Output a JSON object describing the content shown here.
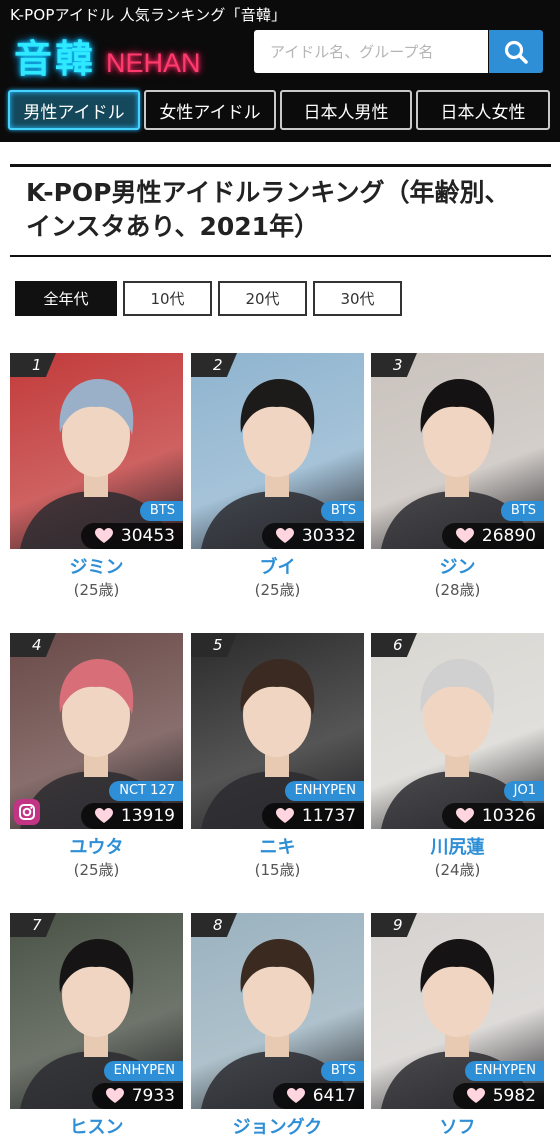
{
  "header": {
    "tagline": "K-POPアイドル 人気ランキング「音韓」",
    "logo_jp": "音韓",
    "logo_en": "NEHAN",
    "search_placeholder": "アイドル名、グループ名"
  },
  "nav": [
    "男性アイドル",
    "女性アイドル",
    "日本人男性",
    "日本人女性"
  ],
  "title": "K-POP男性アイドルランキング（年齢別、インスタあり、2021年）",
  "age_filters": [
    "全年代",
    "10代",
    "20代",
    "30代"
  ],
  "idols": [
    {
      "rank": "1",
      "group": "BTS",
      "likes": "30453",
      "name": "ジミン",
      "age": "(25歳)",
      "bg": "#c23a3a",
      "hair": "#9ab0c8",
      "instagram": false
    },
    {
      "rank": "2",
      "group": "BTS",
      "likes": "30332",
      "name": "ブイ",
      "age": "(25歳)",
      "bg": "#8fb4cf",
      "hair": "#1d1a1a",
      "instagram": false
    },
    {
      "rank": "3",
      "group": "BTS",
      "likes": "26890",
      "name": "ジン",
      "age": "(28歳)",
      "bg": "#c9c2bd",
      "hair": "#141212",
      "instagram": false
    },
    {
      "rank": "4",
      "group": "NCT 127",
      "likes": "13919",
      "name": "ユウタ",
      "age": "(25歳)",
      "bg": "#6a4a48",
      "hair": "#d86e78",
      "instagram": true
    },
    {
      "rank": "5",
      "group": "ENHYPEN",
      "likes": "11737",
      "name": "ニキ",
      "age": "(15歳)",
      "bg": "#2b2b2b",
      "hair": "#3a2a22",
      "instagram": false
    },
    {
      "rank": "6",
      "group": "JO1",
      "likes": "10326",
      "name": "川尻蓮",
      "age": "(24歳)",
      "bg": "#d9d7d2",
      "hair": "#cfd0cf",
      "instagram": false
    },
    {
      "rank": "7",
      "group": "ENHYPEN",
      "likes": "7933",
      "name": "ヒスン",
      "age": "",
      "bg": "#4a5246",
      "hair": "#161414",
      "instagram": false
    },
    {
      "rank": "8",
      "group": "BTS",
      "likes": "6417",
      "name": "ジョングク",
      "age": "",
      "bg": "#9ab2bf",
      "hair": "#3b2a20",
      "instagram": false
    },
    {
      "rank": "9",
      "group": "ENHYPEN",
      "likes": "5982",
      "name": "ソフ",
      "age": "",
      "bg": "#d5d2cf",
      "hair": "#151313",
      "instagram": false
    }
  ]
}
